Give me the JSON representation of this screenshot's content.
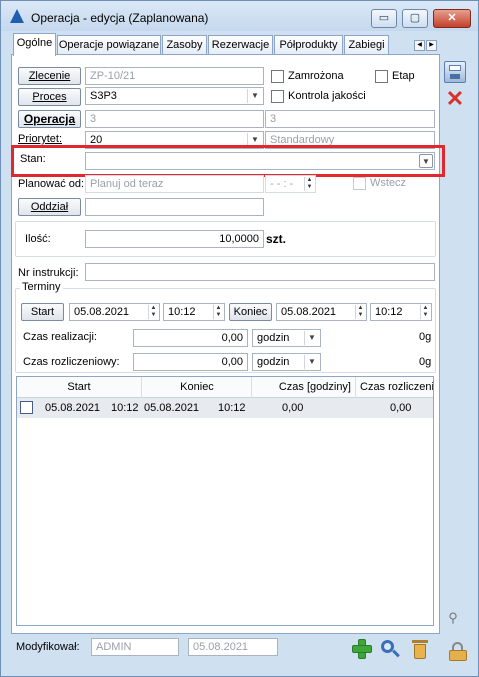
{
  "window": {
    "title": "Operacja - edycja (Zaplanowana)",
    "minimize": "▭",
    "maximize": "▢",
    "close": "✕"
  },
  "tabs": [
    "Ogólne",
    "Operacje powiązane",
    "Zasoby",
    "Rezerwacje",
    "Półprodukty",
    "Zabiegi"
  ],
  "form": {
    "zlecenie_btn": "Zlecenie",
    "zlecenie_val": "ZP-10/21",
    "zamrozona": "Zamrożona",
    "etap": "Etap",
    "proces_btn": "Proces",
    "proces_val": "S3P3",
    "kontrola": "Kontrola jakości",
    "operacja_btn": "Operacja",
    "operacja_val": "3",
    "operacja_val2": "3",
    "priorytet_lbl": "Priorytet:",
    "priorytet_val": "20",
    "priorytet_desc": "Standardowy",
    "stan_lbl": "Stan:",
    "stan_val": "",
    "planowac_lbl": "Planować od:",
    "planowac_val": "Planuj od teraz",
    "planowac_time": "- - : -",
    "wstecz": "Wstecz",
    "oddzial_btn": "Oddział",
    "oddzial_val": "",
    "ilosc_lbl": "Ilość:",
    "ilosc_val": "10,0000",
    "ilosc_unit": "szt.",
    "nr_instr_lbl": "Nr instrukcji:",
    "nr_instr_val": ""
  },
  "terminy": {
    "title": "Terminy",
    "start_btn": "Start",
    "start_date": "05.08.2021",
    "start_time": "10:12",
    "koniec_btn": "Koniec",
    "koniec_date": "05.08.2021",
    "koniec_time": "10:12",
    "czas_real_lbl": "Czas realizacji:",
    "czas_real_val": "0,00",
    "czas_real_unit": "godzin",
    "czas_real_right": "0g",
    "czas_rozl_lbl": "Czas rozliczeniowy:",
    "czas_rozl_val": "0,00",
    "czas_rozl_unit": "godzin",
    "czas_rozl_right": "0g"
  },
  "grid": {
    "headers": [
      "Start",
      "Koniec",
      "Czas [godziny]",
      "Czas rozliczeniowy"
    ],
    "row": {
      "start_date": "05.08.2021",
      "start_time": "10:12",
      "end_date": "05.08.2021",
      "end_time": "10:12",
      "czas": "0,00",
      "czas_rozl": "0,00"
    }
  },
  "footer": {
    "modyfikowal_lbl": "Modyfikował:",
    "user": "ADMIN",
    "date": "05.08.2021"
  },
  "colors": {
    "highlight": "#e0282e",
    "accent": "#1f5fae"
  }
}
